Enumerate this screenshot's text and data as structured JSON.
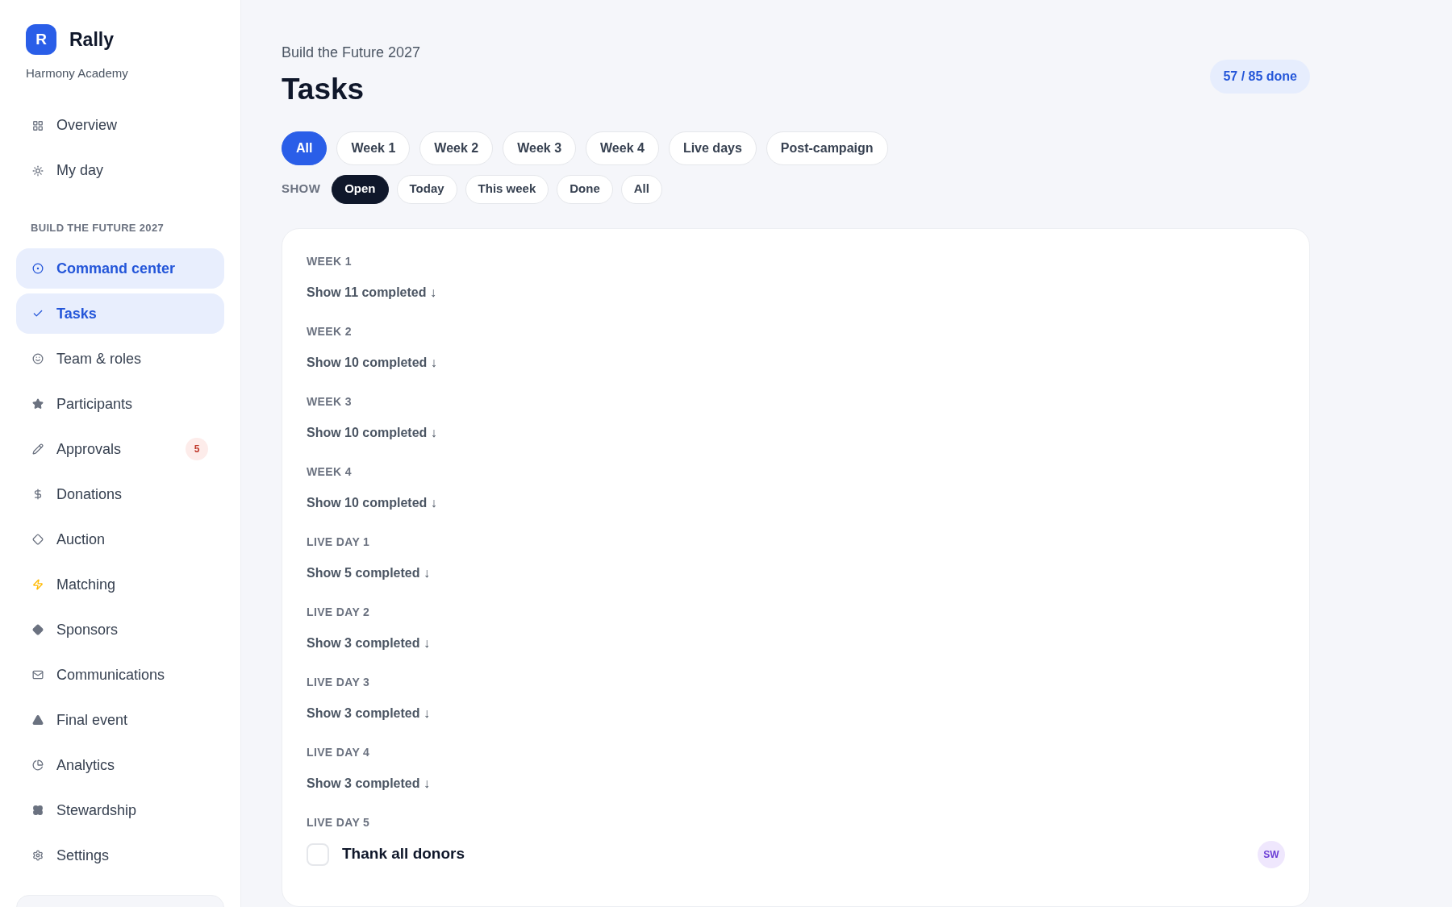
{
  "sidebar": {
    "logo_letter": "R",
    "app_name": "Rally",
    "org": "Harmony Academy",
    "top_items": [
      {
        "label": "Overview",
        "selected": false
      },
      {
        "label": "My day",
        "selected": false
      }
    ],
    "section_title": "BUILD THE FUTURE 2027",
    "items": [
      {
        "label": "Command center",
        "selected": true
      },
      {
        "label": "Tasks",
        "selected": true
      },
      {
        "label": "Team & roles",
        "selected": false
      },
      {
        "label": "Participants",
        "selected": false
      },
      {
        "label": "Approvals",
        "selected": false,
        "badge": "5"
      },
      {
        "label": "Donations",
        "selected": false
      },
      {
        "label": "Auction",
        "selected": false
      },
      {
        "label": "Matching",
        "selected": false
      },
      {
        "label": "Sponsors",
        "selected": false
      },
      {
        "label": "Communications",
        "selected": false
      },
      {
        "label": "Final event",
        "selected": false
      },
      {
        "label": "Analytics",
        "selected": false
      },
      {
        "label": "Stewardship",
        "selected": false
      },
      {
        "label": "Settings",
        "selected": false
      }
    ]
  },
  "header": {
    "breadcrumb": "Build the Future 2027",
    "title": "Tasks",
    "progress": "57 / 85 done"
  },
  "phase_tabs": [
    {
      "label": "All",
      "selected": true
    },
    {
      "label": "Week 1",
      "selected": false
    },
    {
      "label": "Week 2",
      "selected": false
    },
    {
      "label": "Week 3",
      "selected": false
    },
    {
      "label": "Week 4",
      "selected": false
    },
    {
      "label": "Live days",
      "selected": false
    },
    {
      "label": "Post-campaign",
      "selected": false
    }
  ],
  "show_filter": {
    "label": "SHOW",
    "options": [
      {
        "label": "Open",
        "selected": true
      },
      {
        "label": "Today",
        "selected": false
      },
      {
        "label": "This week",
        "selected": false
      },
      {
        "label": "Done",
        "selected": false
      },
      {
        "label": "All",
        "selected": false
      }
    ]
  },
  "groups": [
    {
      "title": "WEEK 1",
      "toggle": "Show 11 completed ↓"
    },
    {
      "title": "WEEK 2",
      "toggle": "Show 10 completed ↓"
    },
    {
      "title": "WEEK 3",
      "toggle": "Show 10 completed ↓"
    },
    {
      "title": "WEEK 4",
      "toggle": "Show 10 completed ↓"
    },
    {
      "title": "LIVE DAY 1",
      "toggle": "Show 5 completed ↓"
    },
    {
      "title": "LIVE DAY 2",
      "toggle": "Show 3 completed ↓"
    },
    {
      "title": "LIVE DAY 3",
      "toggle": "Show 3 completed ↓"
    },
    {
      "title": "LIVE DAY 4",
      "toggle": "Show 3 completed ↓"
    },
    {
      "title": "LIVE DAY 5",
      "tasks": [
        {
          "title": "Thank all donors",
          "checked": false,
          "assignee": "SW"
        }
      ]
    }
  ]
}
